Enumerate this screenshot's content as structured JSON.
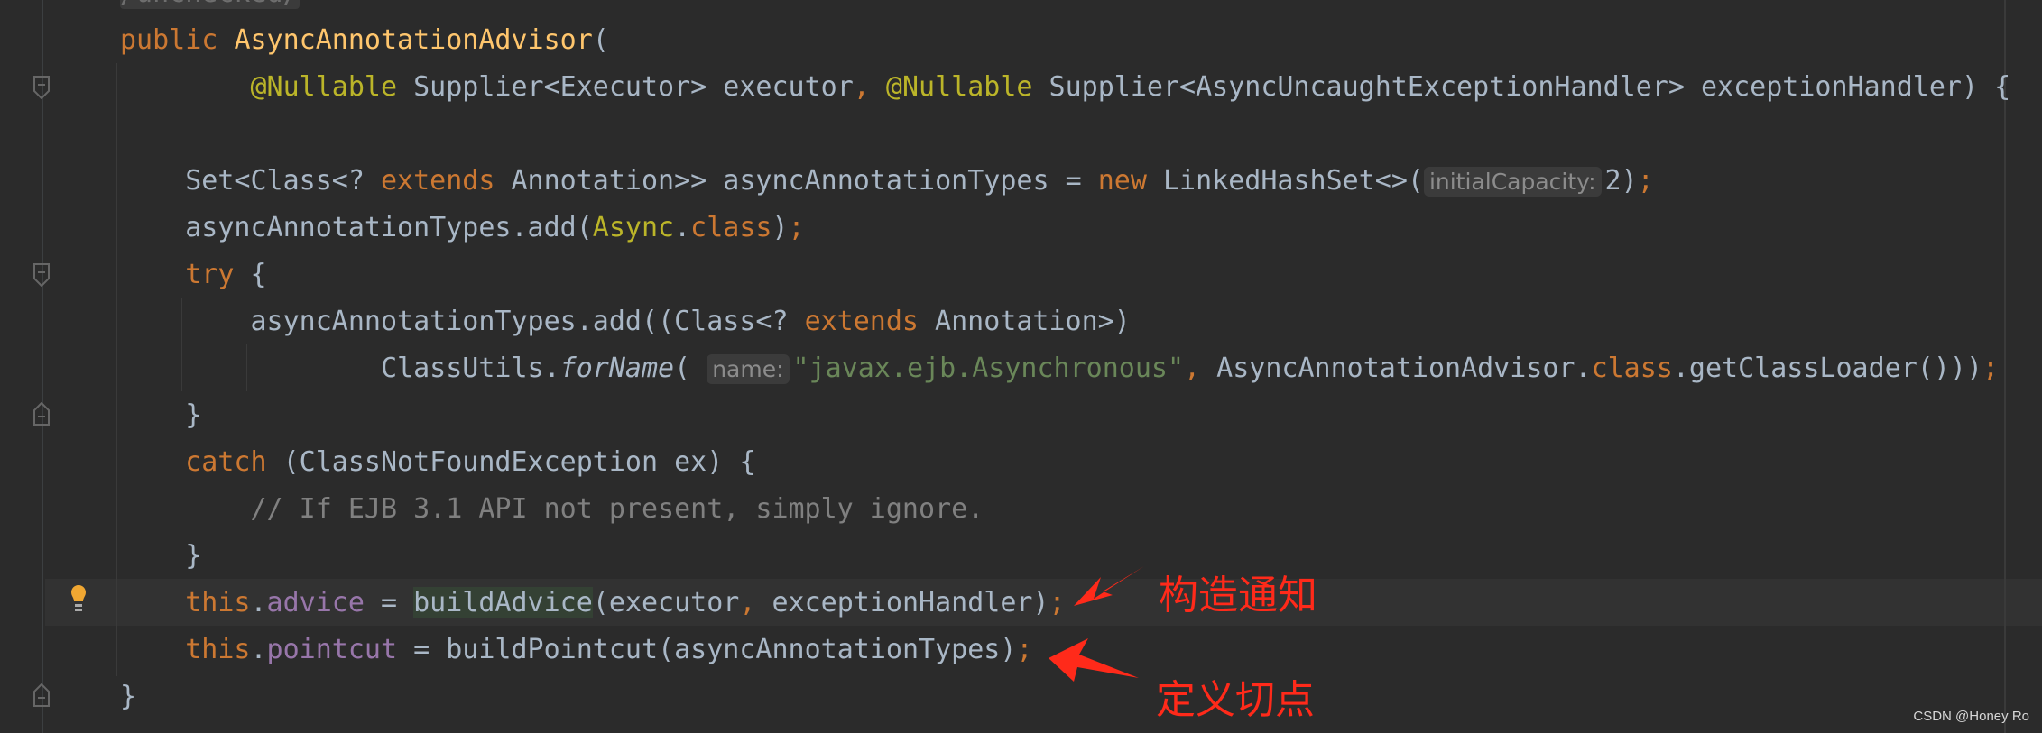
{
  "editor": {
    "colors": {
      "background": "#2b2b2b",
      "keyword": "#cc7832",
      "method_decl": "#ffc66d",
      "text": "#a9b7c6",
      "annotation": "#bbb529",
      "string": "#6a8759",
      "comment": "#808080",
      "field": "#9876aa",
      "annotation_red": "#ff2a1a"
    },
    "lines": [
      {
        "indent": 0,
        "tokens": [
          [
            "fold-box",
            "/unchecked/"
          ]
        ]
      },
      {
        "indent": 0,
        "tokens": [
          [
            "kw",
            "public "
          ],
          [
            "fn",
            "AsyncAnnotationAdvisor"
          ],
          [
            "",
            "("
          ]
        ]
      },
      {
        "indent": 8,
        "tokens": [
          [
            "ann",
            "@Nullable"
          ],
          [
            "",
            " Supplier<Executor> executor"
          ],
          [
            "kw",
            ", "
          ],
          [
            "ann",
            "@Nullable"
          ],
          [
            "",
            " Supplier<AsyncUncaughtExceptionHandler> exceptionHandler) {"
          ]
        ]
      },
      {
        "indent": 0,
        "tokens": []
      },
      {
        "indent": 4,
        "tokens": [
          [
            "",
            "Set<Class<? "
          ],
          [
            "kw",
            "extends"
          ],
          [
            "",
            " Annotation>> asyncAnnotationTypes = "
          ],
          [
            "kw",
            "new"
          ],
          [
            "",
            " LinkedHashSet<>("
          ],
          [
            "hint",
            "initialCapacity:"
          ],
          [
            "",
            "2)"
          ],
          [
            "kw",
            ";"
          ]
        ]
      },
      {
        "indent": 4,
        "tokens": [
          [
            "",
            "asyncAnnotationTypes.add("
          ],
          [
            "ann",
            "Async"
          ],
          [
            "",
            "."
          ],
          [
            "kw",
            "class"
          ],
          [
            "",
            ")"
          ],
          [
            "kw",
            ";"
          ]
        ]
      },
      {
        "indent": 4,
        "tokens": [
          [
            "kw",
            "try"
          ],
          [
            "",
            " {"
          ]
        ]
      },
      {
        "indent": 8,
        "tokens": [
          [
            "",
            "asyncAnnotationTypes.add((Class<? "
          ],
          [
            "kw",
            "extends"
          ],
          [
            "",
            " Annotation>)"
          ]
        ]
      },
      {
        "indent": 16,
        "tokens": [
          [
            "",
            "ClassUtils."
          ],
          [
            "it",
            "forName"
          ],
          [
            "",
            "( "
          ],
          [
            "hint",
            "name:"
          ],
          [
            "str",
            "\"javax.ejb.Asynchronous\""
          ],
          [
            "kw",
            ", "
          ],
          [
            "",
            "AsyncAnnotationAdvisor."
          ],
          [
            "kw",
            "class"
          ],
          [
            "",
            ".getClassLoader()))"
          ],
          [
            "kw",
            ";"
          ]
        ]
      },
      {
        "indent": 4,
        "tokens": [
          [
            "",
            "}"
          ]
        ]
      },
      {
        "indent": 4,
        "tokens": [
          [
            "kw",
            "catch"
          ],
          [
            "",
            " (ClassNotFoundException ex) {"
          ]
        ]
      },
      {
        "indent": 8,
        "tokens": [
          [
            "cm",
            "// If EJB 3.1 API not present, simply ignore."
          ]
        ]
      },
      {
        "indent": 4,
        "tokens": [
          [
            "",
            "}"
          ]
        ]
      },
      {
        "indent": 4,
        "tokens": [
          [
            "kw",
            "this"
          ],
          [
            "",
            "."
          ],
          [
            "fld",
            "advice"
          ],
          [
            "",
            " = "
          ],
          [
            "hl",
            "buildAdvice"
          ],
          [
            "",
            "(executor"
          ],
          [
            "kw",
            ", "
          ],
          [
            "",
            "exceptionHandler)"
          ],
          [
            "kw",
            ";"
          ]
        ]
      },
      {
        "indent": 4,
        "tokens": [
          [
            "kw",
            "this"
          ],
          [
            "",
            "."
          ],
          [
            "fld",
            "pointcut"
          ],
          [
            "",
            " = buildPointcut(asyncAnnotationTypes)"
          ],
          [
            "kw",
            ";"
          ]
        ]
      },
      {
        "indent": 0,
        "tokens": [
          [
            "",
            "}"
          ]
        ]
      }
    ]
  },
  "annotations": {
    "advice_note": "构造通知",
    "pointcut_note": "定义切点"
  },
  "watermark": "CSDN @Honey Ro",
  "icons": {
    "fold": "fold-marker-icon",
    "bulb": "lightbulb-icon"
  }
}
